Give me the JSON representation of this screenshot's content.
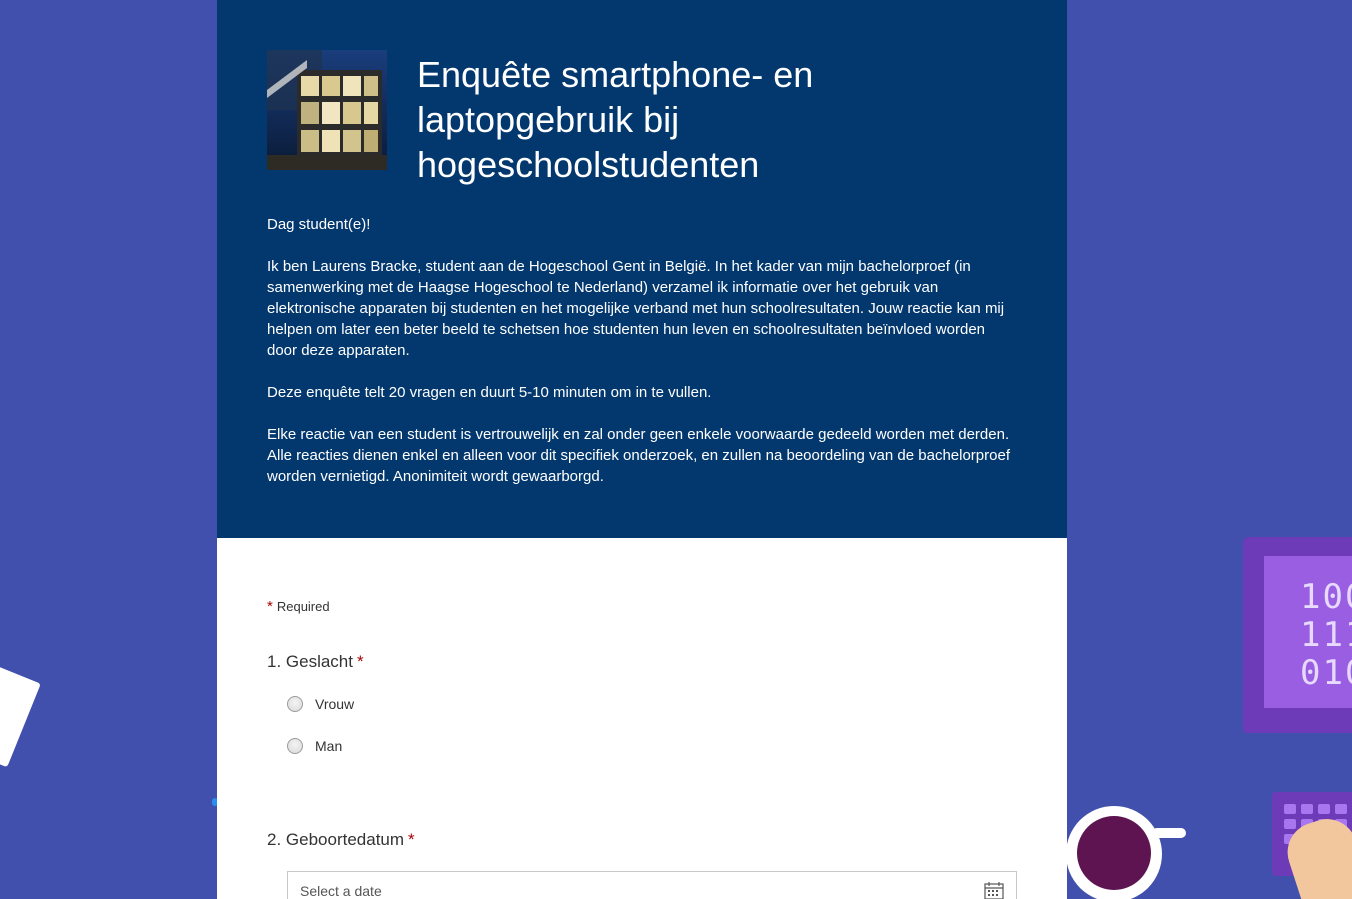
{
  "form": {
    "title": "Enquête smartphone- en laptopgebruik bij hogeschoolstudenten",
    "description": [
      "Dag student(e)!",
      "Ik ben Laurens Bracke, student aan de Hogeschool Gent in België. In het kader van mijn bachelorproef (in samenwerking met de Haagse Hogeschool te Nederland) verzamel ik informatie over het gebruik van elektronische apparaten bij studenten en het mogelijke verband met hun schoolresultaten. Jouw reactie kan mij helpen om later een beter beeld te schetsen hoe studenten hun leven en schoolresultaten beïnvloed worden door deze apparaten.",
      "Deze enquête telt 20 vragen en duurt 5-10 minuten om in te vullen.",
      "Elke reactie van een student is vertrouwelijk en zal onder geen enkele voorwaarde gedeeld worden met derden. Alle reacties dienen enkel en alleen voor dit specifiek onderzoek, en zullen na beoordeling van de bachelorproef worden vernietigd. Anonimiteit wordt gewaarborgd."
    ],
    "required_star": "*",
    "required_label": "Required"
  },
  "questions": [
    {
      "label": "1. Geslacht",
      "required_star": "*",
      "options": [
        "Vrouw",
        "Man"
      ]
    },
    {
      "label": "2. Geboortedatum",
      "required_star": "*",
      "placeholder": "Select a date"
    }
  ],
  "colors": {
    "background": "#4150ad",
    "header": "#03386f",
    "required": "#a80000"
  },
  "icons": {
    "calendar": "calendar-icon",
    "header_image": "building-photo"
  }
}
